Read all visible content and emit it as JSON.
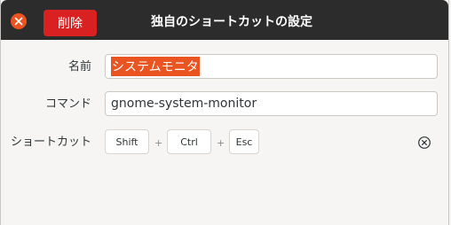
{
  "header": {
    "title": "独自のショートカットの設定",
    "delete_label": "削除"
  },
  "form": {
    "name_label": "名前",
    "name_value": "システムモニタ",
    "command_label": "コマンド",
    "command_value": "gnome-system-monitor",
    "shortcut_label": "ショートカット",
    "shortcut_keys": [
      "Shift",
      "Ctrl",
      "Esc"
    ],
    "separator": "+"
  },
  "colors": {
    "accent": "#e95420",
    "destructive": "#da2121",
    "headerbar": "#2c2c2c"
  }
}
